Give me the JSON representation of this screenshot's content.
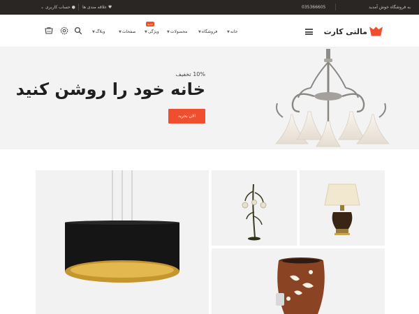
{
  "topbar": {
    "welcome": "به فروشگاه خوش آمدید",
    "phone": "035366605",
    "wishlist": "علاقه مندی ها",
    "account": "حساب کاربری"
  },
  "header": {
    "logo_text": "مالتی کارت",
    "nav": {
      "home": "خانه",
      "shop": "فروشگاه",
      "products": "محصولات",
      "features": "ویژگی",
      "pages": "صفحات",
      "blog": "وبلاگ"
    },
    "badge": "جدید"
  },
  "hero": {
    "discount": "10% تخفیف",
    "title": "خانه خود را روشن کنید",
    "cta": "الان بخرید"
  },
  "colors": {
    "accent": "#ef4f2e",
    "topbar_bg": "#2a2624",
    "hero_bg": "#f3f3f3"
  },
  "icons": [
    "heart-icon",
    "user-icon",
    "cart-icon",
    "settings-icon",
    "search-icon",
    "menu-icon"
  ]
}
